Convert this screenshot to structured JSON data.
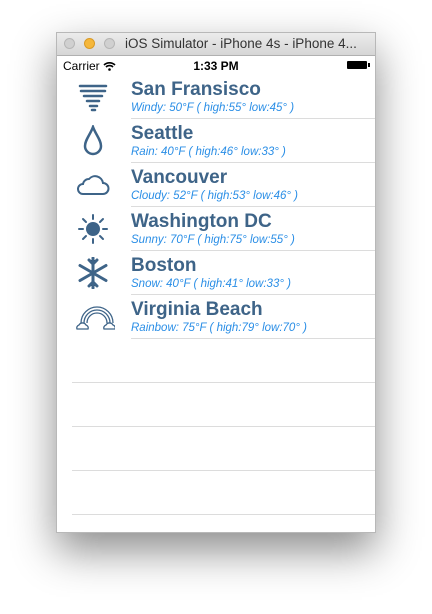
{
  "window": {
    "title": "iOS Simulator - iPhone 4s - iPhone 4..."
  },
  "status_bar": {
    "carrier": "Carrier",
    "time": "1:33 PM"
  },
  "colors": {
    "city": "#3e6488",
    "detail": "#2a8ee6"
  },
  "rows": [
    {
      "icon": "tornado-icon",
      "city": "San Fransisco",
      "detail": "Windy: 50°F ( high:55° low:45° )"
    },
    {
      "icon": "raindrop-icon",
      "city": "Seattle",
      "detail": "Rain: 40°F ( high:46° low:33° )"
    },
    {
      "icon": "cloud-icon",
      "city": "Vancouver",
      "detail": "Cloudy: 52°F ( high:53° low:46° )"
    },
    {
      "icon": "sun-icon",
      "city": "Washington DC",
      "detail": "Sunny: 70°F ( high:75° low:55° )"
    },
    {
      "icon": "snowflake-icon",
      "city": "Boston",
      "detail": "Snow: 40°F ( high:41° low:33° )"
    },
    {
      "icon": "rainbow-icon",
      "city": "Virginia Beach",
      "detail": "Rainbow: 75°F ( high:79° low:70° )"
    }
  ]
}
